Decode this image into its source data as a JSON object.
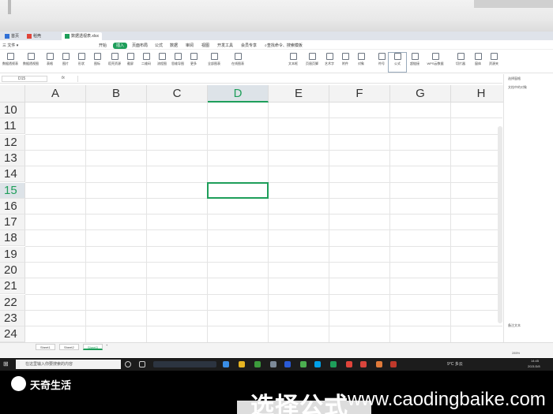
{
  "tabs": [
    {
      "label": "首页"
    },
    {
      "label": "稻壳"
    },
    {
      "label": "数据透视表.xlsx",
      "active": true
    }
  ],
  "menu": [
    "开始",
    "插入",
    "页面布局",
    "公式",
    "数据",
    "审阅",
    "视图",
    "开发工具",
    "会员专享",
    "查找命令、搜索模板"
  ],
  "menu_selected": "插入",
  "ribbon": [
    "数据透视表",
    "数据透视图",
    "表格",
    "图片",
    "形状",
    "图标",
    "稻壳资源",
    "截屏",
    "二维码",
    "流程图",
    "思维导图",
    "更多",
    "全部图表",
    "在线图表",
    "文本框",
    "页眉页脚",
    "艺术字",
    "附件",
    "对象",
    "符号",
    "公式",
    "超链接",
    "WPS云数据",
    "切片器",
    "窗体",
    "资源夹"
  ],
  "name_box": "D15",
  "fx_label": "fx",
  "columns": [
    "A",
    "B",
    "C",
    "D",
    "E",
    "F",
    "G",
    "H"
  ],
  "active_column": "D",
  "rows": [
    "10",
    "11",
    "12",
    "13",
    "14",
    "15",
    "16",
    "17",
    "18",
    "19",
    "20",
    "21",
    "22",
    "23",
    "24"
  ],
  "active_row": "15",
  "sheets": [
    "Sheet1",
    "Sheet2",
    "Sheet3"
  ],
  "active_sheet": "Sheet3",
  "side_panel": {
    "title": "选择窗格",
    "subtitle": "文档中的对象",
    "footer": "备注文本"
  },
  "status": {
    "zoom": "285%"
  },
  "taskbar": {
    "search_placeholder": "在这里输入你要搜索的内容",
    "weather": "9°C 多云",
    "time": "14:45",
    "date": "2021/3/8"
  },
  "watermark": "天奇生活",
  "caption": "选择公式",
  "url": "www.caodingbaike.com",
  "colors": {
    "accent": "#1e9e5a",
    "header_bg": "#f3f3f3",
    "taskbar": "#1c1c1c"
  }
}
